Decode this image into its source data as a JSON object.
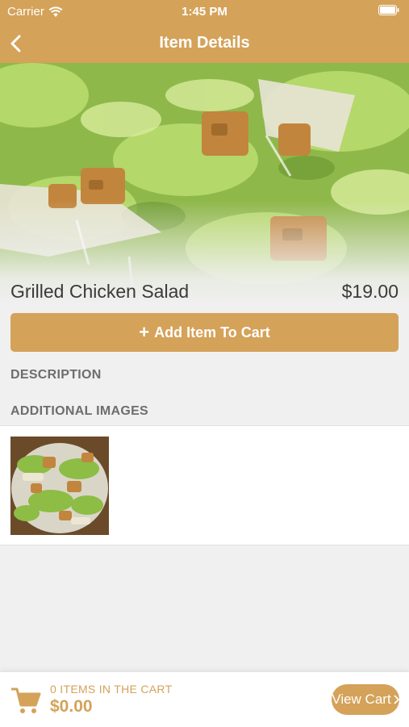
{
  "status_bar": {
    "carrier": "Carrier",
    "time": "1:45 PM"
  },
  "nav": {
    "title": "Item Details",
    "back_icon": "chevron-left-icon"
  },
  "item": {
    "name": "Grilled Chicken Salad",
    "price": "$19.00"
  },
  "actions": {
    "add_to_cart_label": "Add Item To Cart",
    "add_icon": "plus-icon"
  },
  "sections": {
    "description_label": "DESCRIPTION",
    "additional_images_label": "ADDITIONAL IMAGES"
  },
  "cart": {
    "items_label": "0 ITEMS IN THE CART",
    "total": "$0.00",
    "view_cart_label": "View Cart",
    "cart_icon": "cart-icon"
  },
  "colors": {
    "accent": "#d4a259",
    "background": "#f0f0f0",
    "text": "#3a3a3a"
  }
}
